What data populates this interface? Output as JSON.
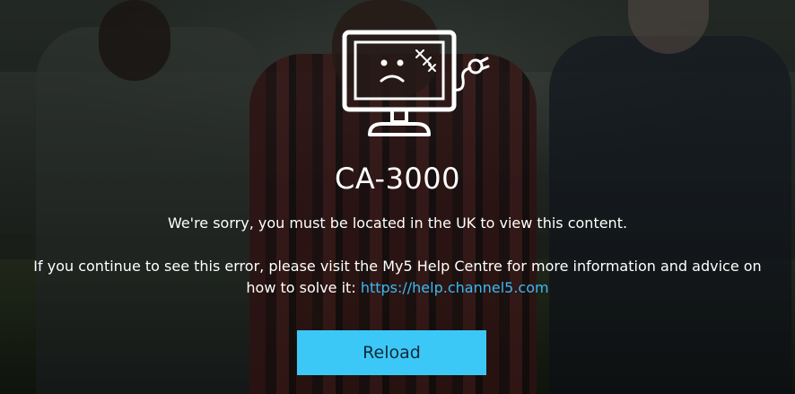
{
  "error": {
    "code": "CA-3000",
    "message": "We're sorry, you must be located in the UK to view this content.",
    "help_text": "If you continue to see this error, please visit the My5 Help Centre for more information and advice on how to solve it:",
    "help_link": "https://help.channel5.com",
    "icon": "broken-monitor-icon"
  },
  "actions": {
    "reload_label": "Reload"
  },
  "colors": {
    "accent": "#3cc8f7",
    "link": "#3db8f5",
    "text": "#ffffff"
  }
}
